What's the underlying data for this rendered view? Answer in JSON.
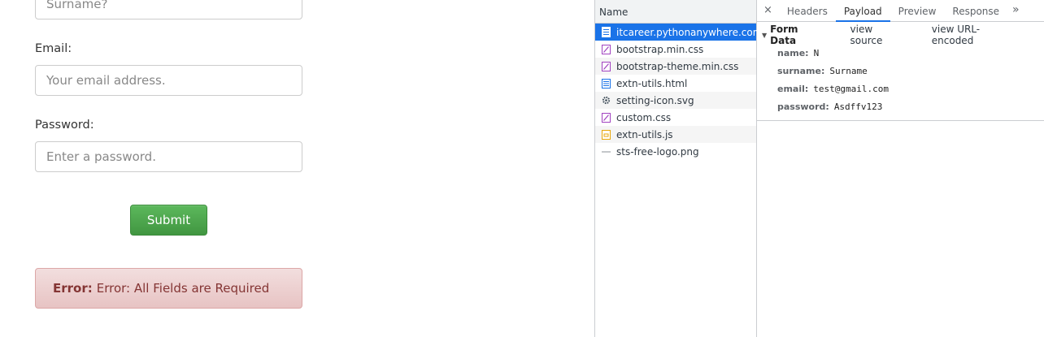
{
  "form": {
    "surname_placeholder": "Surname?",
    "email_label": "Email:",
    "email_placeholder": "Your email address.",
    "password_label": "Password:",
    "password_placeholder": "Enter a password.",
    "submit_label": "Submit",
    "error_strong": "Error:",
    "error_message": "Error: All Fields are Required"
  },
  "devtools": {
    "name_header": "Name",
    "requests": [
      {
        "name": "itcareer.pythonanywhere.com",
        "icon": "document-icon",
        "selected": true
      },
      {
        "name": "bootstrap.min.css",
        "icon": "stylesheet-icon"
      },
      {
        "name": "bootstrap-theme.min.css",
        "icon": "stylesheet-icon"
      },
      {
        "name": "extn-utils.html",
        "icon": "document-icon"
      },
      {
        "name": "setting-icon.svg",
        "icon": "gear-icon"
      },
      {
        "name": "custom.css",
        "icon": "stylesheet-icon"
      },
      {
        "name": "extn-utils.js",
        "icon": "script-icon"
      },
      {
        "name": "sts-free-logo.png",
        "icon": "image-icon"
      }
    ],
    "tabs": {
      "close": "×",
      "headers": "Headers",
      "payload": "Payload",
      "preview": "Preview",
      "response": "Response",
      "more": "»",
      "active": "Payload"
    },
    "payload": {
      "section_title": "Form Data",
      "view_source": "view source",
      "view_url_encoded": "view URL-encoded",
      "fields": [
        {
          "key": "name:",
          "value": "N"
        },
        {
          "key": "surname:",
          "value": "Surname"
        },
        {
          "key": "email:",
          "value": "test@gmail.com"
        },
        {
          "key": "password:",
          "value": "Asdffv123"
        }
      ]
    }
  },
  "colors": {
    "selection": "#1a73e8",
    "submit": "#5cb85c",
    "alert_bg": "#f2dede",
    "alert_text": "#843534"
  }
}
